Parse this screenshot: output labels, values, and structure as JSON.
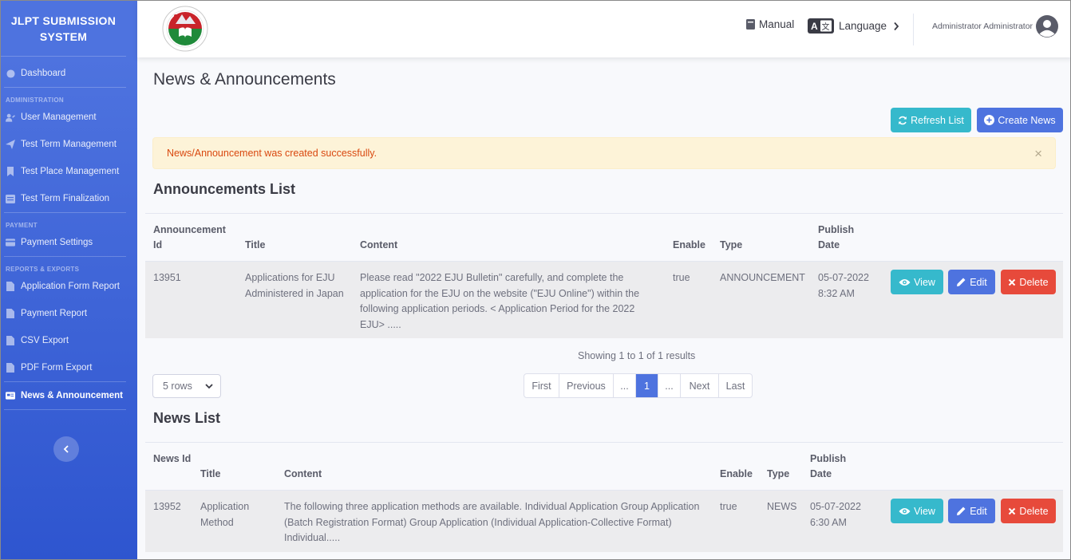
{
  "app": {
    "title": "JLPT SUBMISSION SYSTEM"
  },
  "sidebar": {
    "dashboard": "Dashboard",
    "administration_heading": "ADMINISTRATION",
    "admin_items": [
      "User Management",
      "Test Term Management",
      "Test Place Management",
      "Test Term Finalization"
    ],
    "payment_heading": "PAYMENT",
    "payment_items": [
      "Payment Settings"
    ],
    "reports_heading": "REPORTS & EXPORTS",
    "report_items": [
      "Application Form Report",
      "Payment Report",
      "CSV Export",
      "PDF Form Export"
    ],
    "active_item": "News & Announcement"
  },
  "topbar": {
    "manual": "Manual",
    "language": "Language",
    "user_name": "Administrator Administrator"
  },
  "page": {
    "title": "News & Announcements",
    "refresh_button": "Refresh List",
    "create_button": "Create News",
    "alert_message": "News/Announcement was created successfully.",
    "alert_close": "×"
  },
  "announcements": {
    "title": "Announcements List",
    "headers": {
      "id": "Announcement Id",
      "title": "Title",
      "content": "Content",
      "enable": "Enable",
      "type": "Type",
      "publish": "Publish Date"
    },
    "rows": [
      {
        "id": "13951",
        "title": "Applications for EJU Administered in Japan",
        "content": "Please read \"2022 EJU Bulletin\" carefully, and complete the application for the EJU on the website (\"EJU Online\") within the following application periods. < Application Period for the 2022 EJU> .....",
        "enable": "true",
        "type": "ANNOUNCEMENT",
        "publish_date": "05-07-2022",
        "publish_time": "8:32 AM"
      }
    ],
    "showing": "Showing 1 to 1 of 1 results",
    "rows_per_page": "5 rows",
    "pager": {
      "first": "First",
      "previous": "Previous",
      "ellipsis": "...",
      "current": "1",
      "next": "Next",
      "last": "Last"
    }
  },
  "news": {
    "title": "News List",
    "headers": {
      "id": "News Id",
      "title": "Title",
      "content": "Content",
      "enable": "Enable",
      "type": "Type",
      "publish": "Publish Date"
    },
    "rows": [
      {
        "id": "13952",
        "title": "Application Method",
        "content": "The following three application methods are available. Individual Application Group Application (Batch Registration Format) Group Application (Individual Application-Collective Format) Individual.....",
        "enable": "true",
        "type": "NEWS",
        "publish_date": "05-07-2022",
        "publish_time": "6:30 AM"
      }
    ]
  },
  "actions": {
    "view": "View",
    "edit": "Edit",
    "delete": "Delete"
  },
  "colors": {
    "primary": "#4e73df",
    "info": "#36b9cc",
    "danger": "#e74a3b",
    "alert_bg": "#fdf3d8"
  }
}
